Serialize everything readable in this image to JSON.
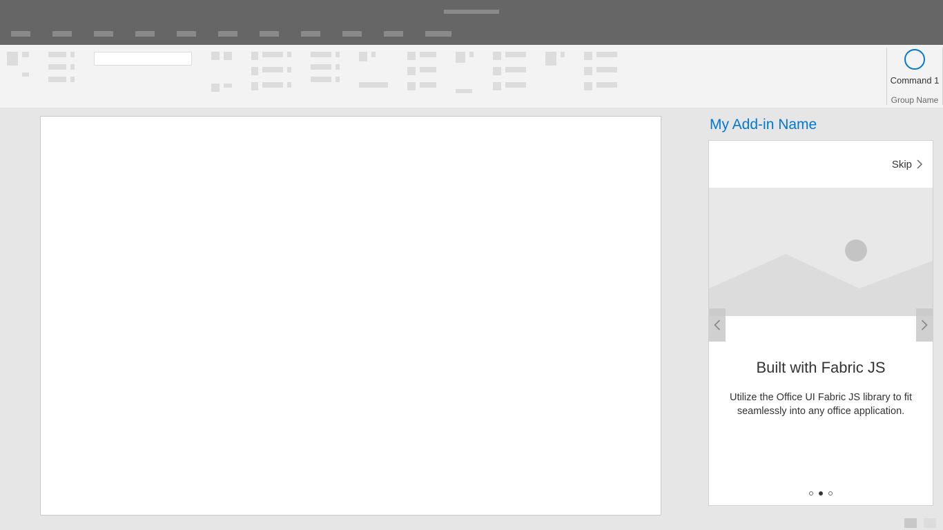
{
  "ribbon": {
    "command_label": "Command 1",
    "group_label": "Group Name"
  },
  "taskpane": {
    "title": "My Add-in Name",
    "skip_label": "Skip",
    "card": {
      "heading": "Built with Fabric JS",
      "body": "Utilize the Office UI Fabric JS library to fit seamlessly into any office application."
    },
    "pagination": {
      "total": 3,
      "active_index": 1
    }
  }
}
